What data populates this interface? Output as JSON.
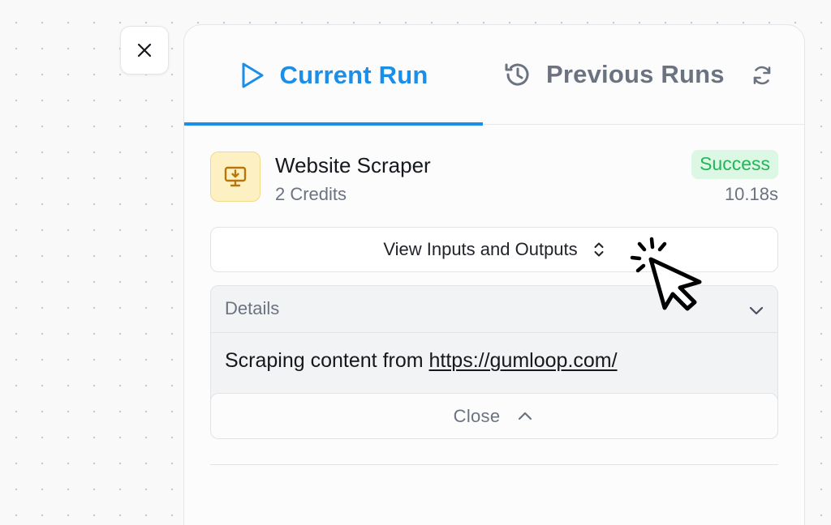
{
  "tabs": {
    "current_label": "Current Run",
    "previous_label": "Previous Runs",
    "current_icon": "play-icon",
    "previous_icon": "history-icon",
    "refresh_icon": "refresh-icon"
  },
  "node": {
    "icon": "monitor-download-icon",
    "title": "Website Scraper",
    "credits": "2 Credits",
    "status": "Success",
    "duration": "10.18s"
  },
  "io_toggle": {
    "label": "View Inputs and Outputs",
    "icon": "chevron-up-down-icon"
  },
  "details": {
    "label": "Details",
    "body_prefix": "Scraping content from ",
    "link_text": "https://gumloop.com/",
    "close_label": "Close"
  },
  "colors": {
    "accent": "#1b8ee8",
    "success_text": "#22b658",
    "success_bg": "#dcf7e3",
    "node_icon_bg": "#fdf1c4",
    "node_icon_fg": "#b8760a",
    "muted": "#6b7380"
  }
}
